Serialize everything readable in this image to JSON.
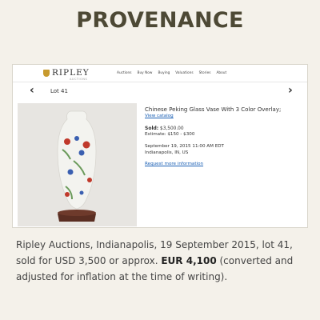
{
  "heading": "PROVENANCE",
  "site": {
    "logo_name": "RIPLEY",
    "logo_sub": "AUCTIONS",
    "logo_color": "#c79a2e",
    "menu": [
      "Auctions",
      "Buy Now",
      "Buying",
      "Valuations",
      "Stories",
      "About"
    ]
  },
  "lot_nav": {
    "prev_icon": "chevron-left-icon",
    "next_icon": "chevron-right-icon",
    "lot_label": "Lot  41"
  },
  "lot": {
    "title": "Chinese Peking Glass Vase With 3 Color Overlay;",
    "view_catalog": "View catalog",
    "sold_label": "Sold:",
    "sold_value": "$3,500.00",
    "estimate": "Estimate:  $150 - $300",
    "date": "September 19, 2015 11:00 AM EDT",
    "location": "Indianapolis, IN, US",
    "request_info": "Request more information"
  },
  "caption": {
    "text": "Ripley Auctions, Indianapolis, 19 September 2015, lot 41, sold for USD 3,500 or approx. ",
    "eur": "EUR 4,100",
    "tail": " (converted and adjusted for inflation at the time of writing)."
  }
}
